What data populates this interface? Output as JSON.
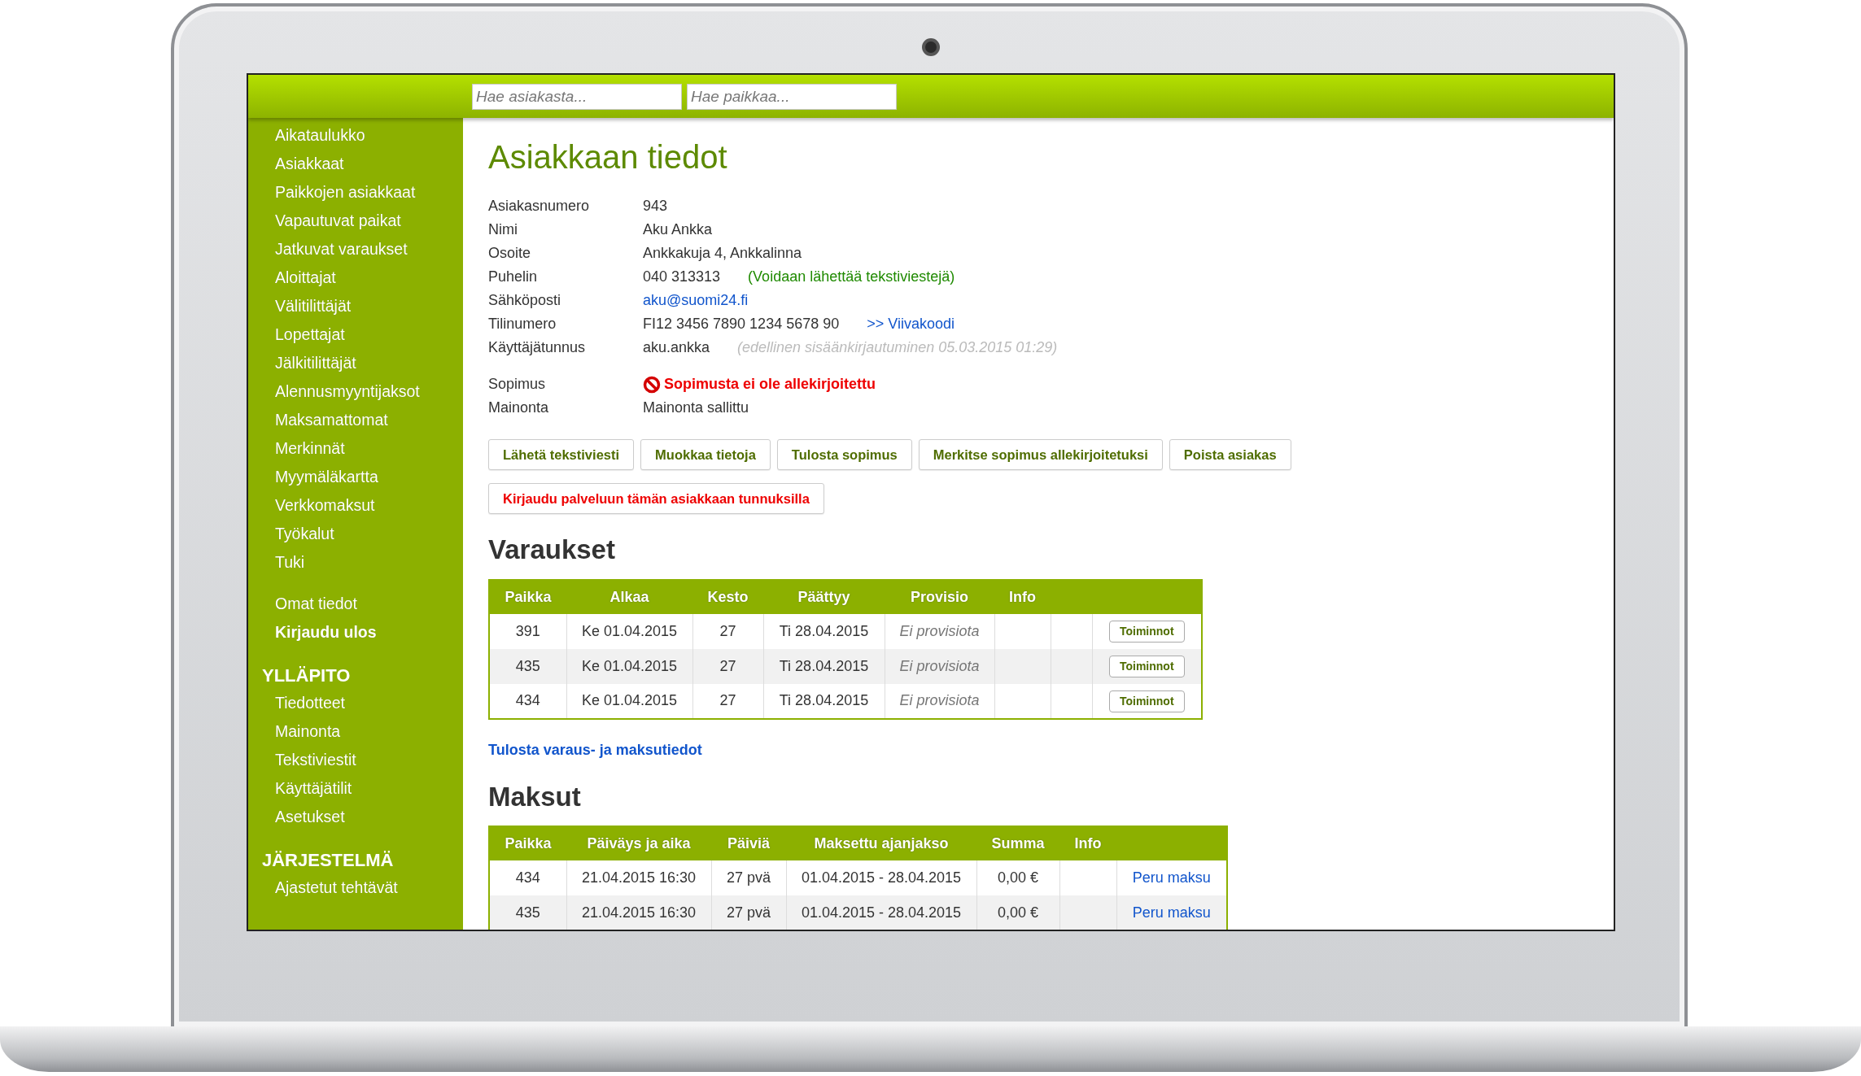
{
  "search": [
    {
      "placeholder": "Hae asiakasta..."
    },
    {
      "placeholder": "Hae paikkaa..."
    }
  ],
  "sidebar": {
    "items": [
      "Aikataulukko",
      "Asiakkaat",
      "Paikkojen asiakkaat",
      "Vapautuvat paikat",
      "Jatkuvat varaukset",
      "Aloittajat",
      "Välitilittäjät",
      "Lopettajat",
      "Jälkitilittäjät",
      "Alennusmyyntijaksot",
      "Maksamattomat",
      "Merkinnät",
      "Myymäläkartta",
      "Verkkomaksut",
      "Työkalut",
      "Tuki"
    ],
    "account": [
      "Omat tiedot"
    ],
    "logout": "Kirjaudu ulos",
    "sections": [
      {
        "title": "YLLÄPITO",
        "items": [
          "Tiedotteet",
          "Mainonta",
          "Tekstiviestit",
          "Käyttäjätilit",
          "Asetukset"
        ]
      },
      {
        "title": "JÄRJESTELMÄ",
        "items": [
          "Ajastetut tehtävät"
        ]
      }
    ]
  },
  "customer": {
    "title": "Asiakkaan tiedot",
    "fields": [
      {
        "label": "Asiakasnumero",
        "value": "943",
        "kind": "text"
      },
      {
        "label": "Nimi",
        "value": "Aku Ankka",
        "kind": "text"
      },
      {
        "label": "Osoite",
        "value": "Ankkakuja 4, Ankkalinna",
        "kind": "text"
      },
      {
        "label": "Puhelin",
        "value": "040 313313",
        "kind": "text",
        "note": {
          "text": "(Voidaan lähettää tekstiviestejä)",
          "kind": "ok"
        }
      },
      {
        "label": "Sähköposti",
        "value": "aku@suomi24.fi",
        "kind": "link"
      },
      {
        "label": "Tilinumero",
        "value": "FI12 3456 7890 1234 5678 90",
        "kind": "text",
        "note": {
          "text": ">> Viivakoodi",
          "kind": "link"
        }
      },
      {
        "label": "Käyttäjätunnus",
        "value": "aku.ankka",
        "kind": "text",
        "note": {
          "text": "(edellinen sisäänkirjautuminen 05.03.2015 01:29)",
          "kind": "muted"
        }
      }
    ],
    "contract_fields": [
      {
        "label": "Sopimus",
        "value": "Sopimusta ei ole allekirjoitettu",
        "kind": "alert"
      },
      {
        "label": "Mainonta",
        "value": "Mainonta sallittu",
        "kind": "text"
      }
    ],
    "action_rows": [
      [
        {
          "label": "Lähetä tekstiviesti",
          "kind": "default"
        },
        {
          "label": "Muokkaa tietoja",
          "kind": "default"
        },
        {
          "label": "Tulosta sopimus",
          "kind": "default"
        },
        {
          "label": "Merkitse sopimus allekirjoitetuksi",
          "kind": "default"
        },
        {
          "label": "Poista asiakas",
          "kind": "default"
        }
      ],
      [
        {
          "label": "Kirjaudu palveluun tämän asiakkaan tunnuksilla",
          "kind": "danger"
        }
      ]
    ]
  },
  "reservations": {
    "title": "Varaukset",
    "columns": [
      "Paikka",
      "Alkaa",
      "Kesto",
      "Päättyy",
      "Provisio",
      "Info"
    ],
    "rows": [
      {
        "place": "391",
        "start": "Ke 01.04.2015",
        "duration": "27",
        "end": "Ti 28.04.2015",
        "commission": "Ei provisiota",
        "action": "Toiminnot"
      },
      {
        "place": "435",
        "start": "Ke 01.04.2015",
        "duration": "27",
        "end": "Ti 28.04.2015",
        "commission": "Ei provisiota",
        "action": "Toiminnot"
      },
      {
        "place": "434",
        "start": "Ke 01.04.2015",
        "duration": "27",
        "end": "Ti 28.04.2015",
        "commission": "Ei provisiota",
        "action": "Toiminnot"
      }
    ],
    "print_link": "Tulosta varaus- ja maksutiedot"
  },
  "payments": {
    "title": "Maksut",
    "columns": [
      "Paikka",
      "Päiväys ja aika",
      "Päiviä",
      "Maksettu ajanjakso",
      "Summa",
      "Info"
    ],
    "rows": [
      {
        "place": "434",
        "date": "21.04.2015 16:30",
        "days": "27 pvä",
        "period": "01.04.2015 - 28.04.2015",
        "sum": "0,00 €",
        "action": "Peru maksu"
      },
      {
        "place": "435",
        "date": "21.04.2015 16:30",
        "days": "27 pvä",
        "period": "01.04.2015 - 28.04.2015",
        "sum": "0,00 €",
        "action": "Peru maksu"
      }
    ]
  }
}
